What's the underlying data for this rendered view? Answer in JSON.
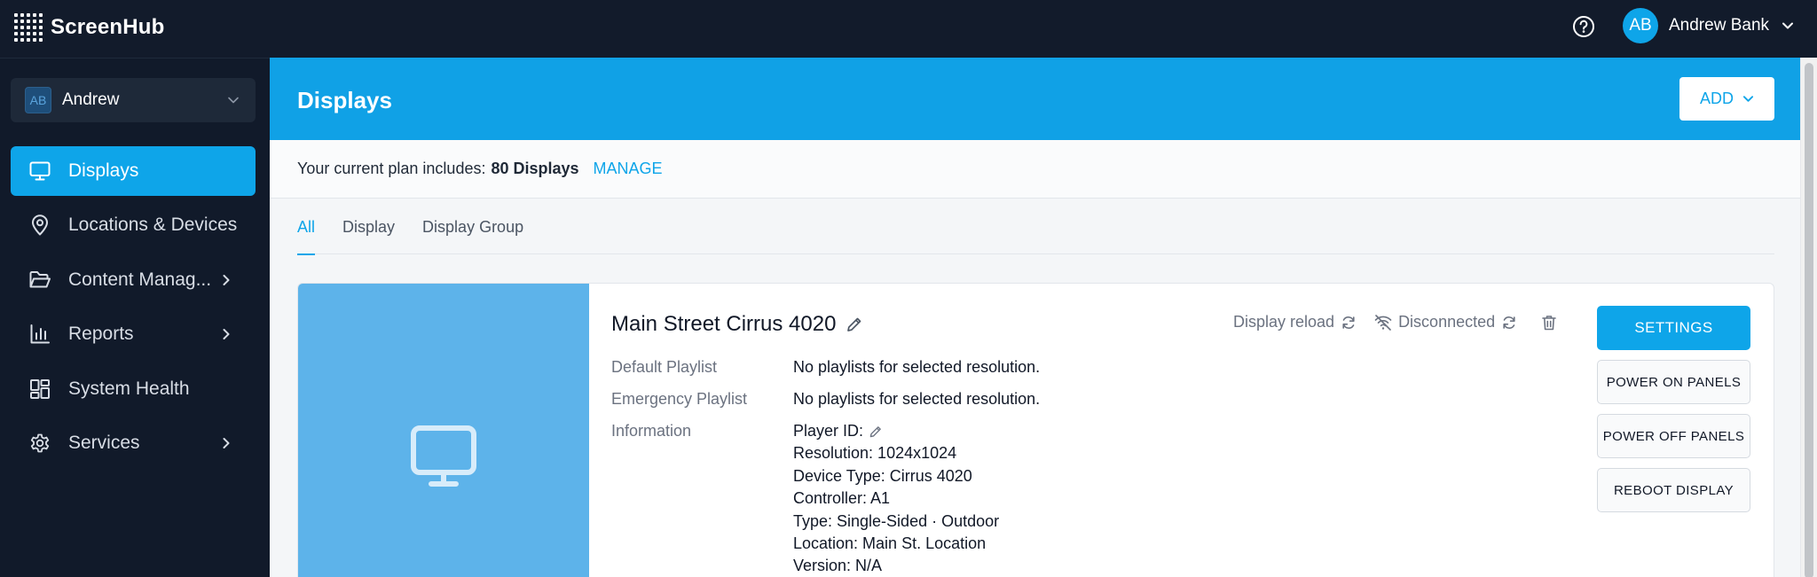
{
  "app": {
    "name": "ScreenHub"
  },
  "topbar": {
    "help_icon": "help-circle-icon",
    "user": {
      "initials": "AB",
      "name": "Andrew Bank"
    }
  },
  "sidebar": {
    "account": {
      "initials": "AB",
      "name": "Andrew"
    },
    "items": [
      {
        "label": "Displays",
        "icon": "monitor-icon",
        "active": true,
        "has_submenu": false
      },
      {
        "label": "Locations & Devices",
        "icon": "map-pin-icon",
        "active": false,
        "has_submenu": false
      },
      {
        "label": "Content Manag...",
        "icon": "folder-icon",
        "active": false,
        "has_submenu": true
      },
      {
        "label": "Reports",
        "icon": "bar-chart-icon",
        "active": false,
        "has_submenu": true
      },
      {
        "label": "System Health",
        "icon": "dashboard-icon",
        "active": false,
        "has_submenu": false
      },
      {
        "label": "Services",
        "icon": "gear-icon",
        "active": false,
        "has_submenu": true
      }
    ]
  },
  "main": {
    "title": "Displays",
    "add_label": "ADD",
    "plan": {
      "prefix": "Your current plan includes:",
      "value": "80 Displays",
      "manage_label": "MANAGE"
    },
    "tabs": [
      {
        "label": "All",
        "active": true
      },
      {
        "label": "Display",
        "active": false
      },
      {
        "label": "Display Group",
        "active": false
      }
    ]
  },
  "display_card": {
    "title": "Main Street Cirrus 4020",
    "display_reload_label": "Display reload",
    "status_label": "Disconnected",
    "default_playlist_label": "Default Playlist",
    "default_playlist_value": "No playlists for selected resolution.",
    "emergency_playlist_label": "Emergency Playlist",
    "emergency_playlist_value": "No playlists for selected resolution.",
    "information_label": "Information",
    "information": {
      "player_id": "Player ID:",
      "resolution": "Resolution: 1024x1024",
      "device_type": "Device Type: Cirrus 4020",
      "controller": "Controller: A1",
      "type": "Type: Single-Sided · Outdoor",
      "location": "Location: Main St. Location",
      "version": "Version: N/A"
    },
    "buttons": {
      "settings": "SETTINGS",
      "power_on": "POWER ON PANELS",
      "power_off": "POWER OFF PANELS",
      "reboot": "REBOOT DISPLAY"
    }
  },
  "colors": {
    "topbar": "#121b2b",
    "sidebar": "#111a2a",
    "accent": "#0ea5e9",
    "header_band": "#10a1e6",
    "thumbnail": "#5db3ea"
  }
}
